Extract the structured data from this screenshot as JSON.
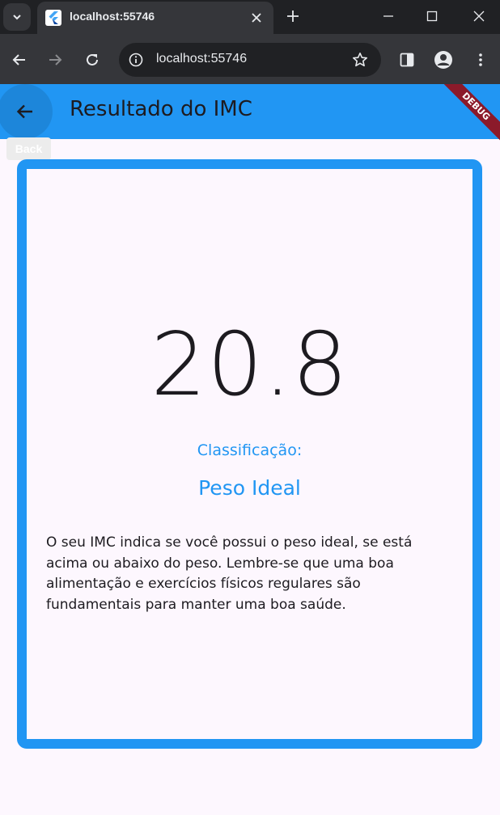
{
  "browser": {
    "tab_title": "localhost:55746",
    "url": "localhost:55746"
  },
  "icons": {
    "tab_menu": "chevron-down-icon",
    "favicon": "flutter-icon",
    "tab_close": "close-icon",
    "new_tab": "plus-icon",
    "minimize": "minimize-icon",
    "maximize": "maximize-icon",
    "window_close": "close-icon",
    "nav_back": "arrow-left-icon",
    "nav_forward": "arrow-right-icon",
    "reload": "reload-icon",
    "site_info": "info-icon",
    "bookmark": "star-icon",
    "side_panel": "side-panel-icon",
    "profile": "profile-icon",
    "menu": "kebab-menu-icon",
    "app_back": "arrow-left-icon"
  },
  "app": {
    "title": "Resultado do IMC",
    "debug_banner": "DEBUG",
    "back_tooltip": "Back",
    "imc_value": "20.8",
    "classification_label": "Classificação:",
    "classification_value": "Peso Ideal",
    "message": "O seu IMC indica se você possui o peso ideal, se está acima ou abaixo do peso. Lembre-se que uma boa alimentação e exercícios físicos regulares são fundamentais para manter uma boa saúde."
  },
  "colors": {
    "primary": "#2196f3",
    "background": "#fdf7fe",
    "text": "#1d1b20",
    "debug_banner": "#8b1a2a",
    "chrome_dark": "#202124",
    "chrome_toolbar": "#35363a"
  }
}
